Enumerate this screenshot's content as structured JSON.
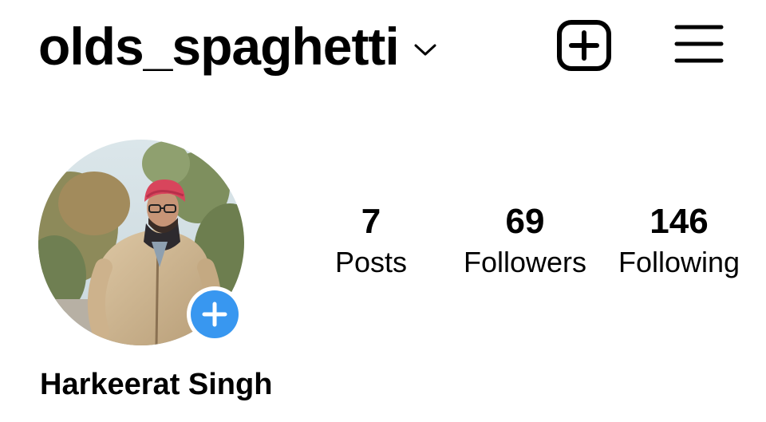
{
  "header": {
    "username": "olds_spaghetti",
    "username_dropdown_icon": "chevron-down-icon",
    "new_post_icon": "plus-square-icon",
    "menu_icon": "hamburger-menu-icon"
  },
  "profile": {
    "avatar_icon": "profile-photo",
    "add_story_icon": "plus-circle-icon",
    "display_name": "Harkeerat Singh",
    "stats": {
      "posts": {
        "value": "7",
        "label": "Posts"
      },
      "followers": {
        "value": "69",
        "label": "Followers"
      },
      "following": {
        "value": "146",
        "label": "Following"
      }
    }
  },
  "colors": {
    "text": "#000000",
    "background": "#ffffff",
    "accent": "#3897f0"
  }
}
